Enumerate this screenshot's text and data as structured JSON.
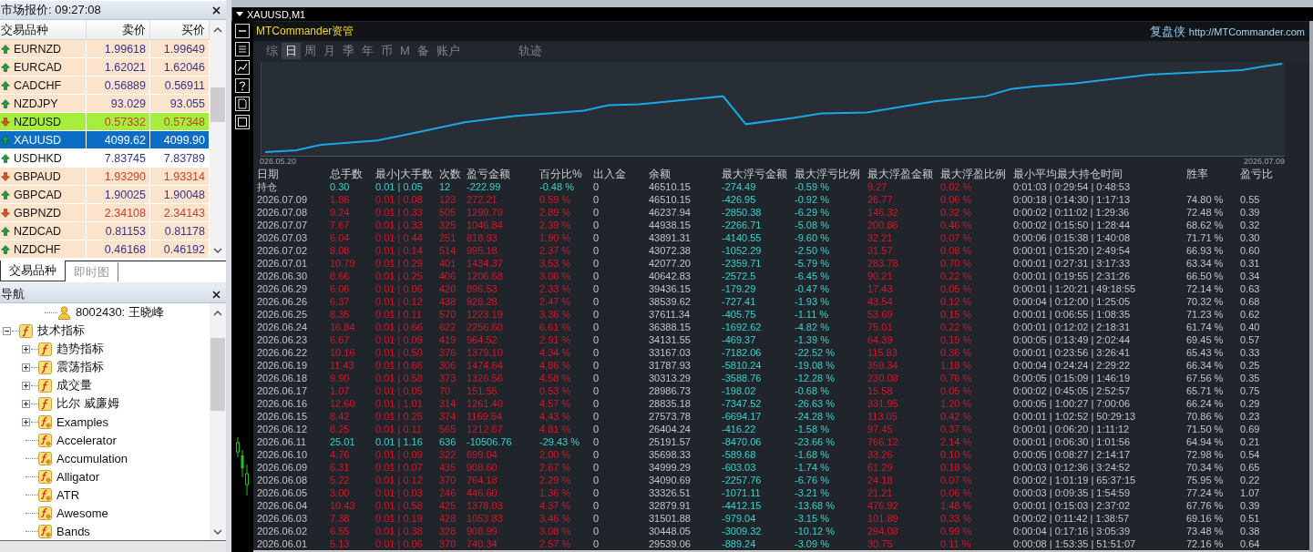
{
  "market_watch": {
    "title": "市场报价: 09:27:08",
    "columns": [
      "交易品种",
      "卖价",
      "买价"
    ],
    "rows": [
      {
        "symbol": "EURNZD",
        "bid": "1.99618",
        "ask": "1.99649",
        "rising": true,
        "selected": false,
        "color": "#fce3cc"
      },
      {
        "symbol": "EURCAD",
        "bid": "1.62021",
        "ask": "1.62046",
        "rising": true,
        "selected": false,
        "color": "#fce3cc"
      },
      {
        "symbol": "CADCHF",
        "bid": "0.56889",
        "ask": "0.56911",
        "rising": true,
        "selected": false,
        "color": "#fce3cc"
      },
      {
        "symbol": "NZDJPY",
        "bid": "93.029",
        "ask": "93.055",
        "rising": true,
        "selected": false,
        "color": "#fce3cc"
      },
      {
        "symbol": "NZDUSD",
        "bid": "0.57332",
        "ask": "0.57348",
        "rising": false,
        "selected": false,
        "color": "#a6ee3c"
      },
      {
        "symbol": "XAUUSD",
        "bid": "4099.62",
        "ask": "4099.90",
        "rising": true,
        "selected": true
      },
      {
        "symbol": "USDHKD",
        "bid": "7.83745",
        "ask": "7.83789",
        "rising": true,
        "selected": false,
        "color": "#ffffff"
      },
      {
        "symbol": "GBPAUD",
        "bid": "1.93290",
        "ask": "1.93314",
        "rising": false,
        "selected": false,
        "color": "#fce3cc"
      },
      {
        "symbol": "GBPCAD",
        "bid": "1.90025",
        "ask": "1.90048",
        "rising": true,
        "selected": false,
        "color": "#fce3cc"
      },
      {
        "symbol": "GBPNZD",
        "bid": "2.34108",
        "ask": "2.34143",
        "rising": false,
        "selected": false,
        "color": "#fce3cc"
      },
      {
        "symbol": "NZDCAD",
        "bid": "0.81153",
        "ask": "0.81178",
        "rising": true,
        "selected": false,
        "color": "#fce3cc"
      },
      {
        "symbol": "NZDCHF",
        "bid": "0.46168",
        "ask": "0.46192",
        "rising": true,
        "selected": false,
        "color": "#fce3cc"
      }
    ],
    "tabs": [
      {
        "label": "交易品种",
        "selected": true
      },
      {
        "label": "即时图",
        "selected": false
      }
    ]
  },
  "navigator": {
    "title": "导航",
    "account": {
      "label": "8002430: 王晓峰"
    },
    "tree": [
      {
        "label": "技术指标",
        "kind": "builtin",
        "expanded": true,
        "children": [
          {
            "label": "趋势指标",
            "kind": "builtin",
            "expanded": false
          },
          {
            "label": "震荡指标",
            "kind": "builtin",
            "expanded": false
          },
          {
            "label": "成交量",
            "kind": "builtin",
            "expanded": false
          },
          {
            "label": "比尔 威廉姆",
            "kind": "builtin",
            "expanded": false
          },
          {
            "label": "Examples",
            "kind": "custom",
            "expanded": false
          },
          {
            "label": "Accelerator",
            "kind": "custom"
          },
          {
            "label": "Accumulation",
            "kind": "custom"
          },
          {
            "label": "Alligator",
            "kind": "custom"
          },
          {
            "label": "ATR",
            "kind": "custom"
          },
          {
            "label": "Awesome",
            "kind": "custom"
          },
          {
            "label": "Bands",
            "kind": "custom"
          }
        ]
      }
    ]
  },
  "chart_window": {
    "title": "XAUUSD,M1",
    "panel": {
      "brand": "MTCommander资管",
      "site_name": "复盘侠",
      "site_url": "http://MTCommander.com",
      "tabs": [
        {
          "label": "综",
          "selected": false
        },
        {
          "label": "日",
          "selected": true
        },
        {
          "label": "周",
          "selected": false
        },
        {
          "label": "月",
          "selected": false
        },
        {
          "label": "季",
          "selected": false
        },
        {
          "label": "年",
          "selected": false
        },
        {
          "label": "币",
          "selected": false
        },
        {
          "label": "M",
          "selected": false
        },
        {
          "label": "备",
          "selected": false
        },
        {
          "label": "账户",
          "selected": false
        },
        {
          "label": "轨迹",
          "selected": false
        }
      ],
      "chart": {
        "start_label": "026.05.20",
        "end_label": "2026.07.09"
      },
      "table": {
        "columns": [
          "日期",
          "总手数",
          "最小|大手数",
          "次数",
          "盈亏金额",
          "百分比%",
          "出入金",
          "余额",
          "最大浮亏金额",
          "最大浮亏比例",
          "最大浮盈金额",
          "最大浮盈比例",
          "最小平均最大持仓时间",
          "胜率",
          "盈亏比"
        ],
        "rows": [
          {
            "cells": [
              "持仓",
              "0.30",
              "0.01 | 0.05",
              "12",
              "-222.99",
              "-0.48 %",
              "0",
              "46510.15",
              "-274.49",
              "-0.59 %",
              "9.27",
              "0.02 %",
              "0:01:03 | 0:29:54 | 0:48:53"
            ],
            "loss": true
          },
          {
            "cells": [
              "2026.07.09",
              "1.86",
              "0.01 | 0.08",
              "123",
              "272.21",
              "0.59 %",
              "0",
              "46510.15",
              "-426.95",
              "-0.92 %",
              "26.77",
              "0.06 %",
              "0:00:18 | 0:14:30 | 1:17:13",
              "74.80 %",
              "0.55"
            ],
            "loss": false
          },
          {
            "cells": [
              "2026.07.08",
              "9.24",
              "0.01 | 0.33",
              "505",
              "1299.79",
              "2.89 %",
              "0",
              "46237.94",
              "-2850.38",
              "-6.29 %",
              "146.32",
              "0.32 %",
              "0:00:02 | 0:11:02 | 1:29:36",
              "72.48 %",
              "0.39"
            ],
            "loss": false
          },
          {
            "cells": [
              "2026.07.07",
              "7.67",
              "0.01 | 0.33",
              "325",
              "1046.84",
              "2.39 %",
              "0",
              "44938.15",
              "-2266.71",
              "-5.08 %",
              "200.86",
              "0.46 %",
              "0:00:02 | 0:15:50 | 1:28:44",
              "68.62 %",
              "0.32"
            ],
            "loss": false
          },
          {
            "cells": [
              "2026.07.03",
              "6.04",
              "0.01 | 0.44",
              "251",
              "818.93",
              "1.90 %",
              "0",
              "43891.31",
              "-4140.55",
              "-9.60 %",
              "32.21",
              "0.07 %",
              "0:00:06 | 0:15:38 | 1:40:08",
              "71.71 %",
              "0.30"
            ],
            "loss": false
          },
          {
            "cells": [
              "2026.07.02",
              "8.08",
              "0.01 | 0.14",
              "514",
              "995.18",
              "2.37 %",
              "0",
              "43072.38",
              "-1052.29",
              "-2.50 %",
              "31.57",
              "0.08 %",
              "0:00:01 | 0:15:20 | 2:49:54",
              "66.93 %",
              "0.60"
            ],
            "loss": false
          },
          {
            "cells": [
              "2026.07.01",
              "10.79",
              "0.01 | 0.29",
              "401",
              "1434.37",
              "3.53 %",
              "0",
              "42077.20",
              "-2359.71",
              "-5.79 %",
              "283.78",
              "0.70 %",
              "0:00:01 | 0:27:31 | 3:17:33",
              "63.34 %",
              "0.31"
            ],
            "loss": false
          },
          {
            "cells": [
              "2026.06.30",
              "8.66",
              "0.01 | 0.25",
              "406",
              "1206.68",
              "3.06 %",
              "0",
              "40642.83",
              "-2572.5",
              "-6.45 %",
              "90.21",
              "0.22 %",
              "0:00:01 | 0:19:55 | 2:31:26",
              "66.50 %",
              "0.34"
            ],
            "loss": false
          },
          {
            "cells": [
              "2026.06.29",
              "6.06",
              "0.01 | 0.06",
              "420",
              "896.53",
              "2.33 %",
              "0",
              "39436.15",
              "-179.29",
              "-0.47 %",
              "17.43",
              "0.05 %",
              "0:00:01 | 1:20:21 | 49:18:55",
              "72.14 %",
              "0.63"
            ],
            "loss": false
          },
          {
            "cells": [
              "2026.06.26",
              "6.37",
              "0.01 | 0.12",
              "438",
              "928.28",
              "2.47 %",
              "0",
              "38539.62",
              "-727.41",
              "-1.93 %",
              "43.54",
              "0.12 %",
              "0:00:04 | 0:12:00 | 1:25:05",
              "70.32 %",
              "0.68"
            ],
            "loss": false
          },
          {
            "cells": [
              "2026.06.25",
              "8.35",
              "0.01 | 0.11",
              "570",
              "1223.19",
              "3.36 %",
              "0",
              "37611.34",
              "-405.75",
              "-1.11 %",
              "53.69",
              "0.15 %",
              "0:00:01 | 0:06:55 | 1:08:35",
              "71.23 %",
              "0.62"
            ],
            "loss": false
          },
          {
            "cells": [
              "2026.06.24",
              "16.84",
              "0.01 | 0.66",
              "622",
              "2256.60",
              "6.61 %",
              "0",
              "36388.15",
              "-1692.62",
              "-4.82 %",
              "75.01",
              "0.22 %",
              "0:00:01 | 0:12:02 | 2:18:31",
              "61.74 %",
              "0.40"
            ],
            "loss": false
          },
          {
            "cells": [
              "2026.06.23",
              "6.67",
              "0.01 | 0.09",
              "419",
              "964.52",
              "2.91 %",
              "0",
              "34131.55",
              "-469.37",
              "-1.39 %",
              "64.39",
              "0.19 %",
              "0:00:05 | 0:13:49 | 2:02:44",
              "69.45 %",
              "0.57"
            ],
            "loss": false
          },
          {
            "cells": [
              "2026.06.22",
              "10.16",
              "0.01 | 0.50",
              "376",
              "1379.10",
              "4.34 %",
              "0",
              "33167.03",
              "-7182.06",
              "-22.52 %",
              "115.83",
              "0.36 %",
              "0:00:01 | 0:23:56 | 3:26:41",
              "65.43 %",
              "0.33"
            ],
            "loss": false
          },
          {
            "cells": [
              "2026.06.19",
              "11.43",
              "0.01 | 0.66",
              "306",
              "1474.64",
              "4.86 %",
              "0",
              "31787.93",
              "-5810.24",
              "-19.08 %",
              "359.34",
              "1.18 %",
              "0:00:04 | 0:24:24 | 2:29:22",
              "66.34 %",
              "0.25"
            ],
            "loss": false
          },
          {
            "cells": [
              "2026.06.18",
              "9.90",
              "0.01 | 0.58",
              "373",
              "1326.56",
              "4.58 %",
              "0",
              "30313.29",
              "-3588.76",
              "-12.28 %",
              "230.08",
              "0.76 %",
              "0:00:05 | 0:15:09 | 1:46:19",
              "67.56 %",
              "0.35"
            ],
            "loss": false
          },
          {
            "cells": [
              "2026.06.17",
              "1.07",
              "0.01 | 0.05",
              "70",
              "151.55",
              "0.53 %",
              "0",
              "28986.73",
              "-198.02",
              "-0.68 %",
              "15.58",
              "0.05 %",
              "0:00:02 | 0:45:05 | 2:52:57",
              "65.71 %",
              "0.75"
            ],
            "loss": false
          },
          {
            "cells": [
              "2026.06.16",
              "12.60",
              "0.01 | 1.01",
              "314",
              "1261.40",
              "4.57 %",
              "0",
              "28835.18",
              "-7347.52",
              "-26.63 %",
              "331.95",
              "1.20 %",
              "0:00:05 | 1:00:27 | 7:00:06",
              "66.24 %",
              "0.29"
            ],
            "loss": false
          },
          {
            "cells": [
              "2026.06.15",
              "8.42",
              "0.01 | 0.25",
              "374",
              "1169.54",
              "4.43 %",
              "0",
              "27573.78",
              "-6694.17",
              "-24.28 %",
              "113.05",
              "0.42 %",
              "0:00:01 | 1:02:52 | 50:29:13",
              "70.86 %",
              "0.23"
            ],
            "loss": false
          },
          {
            "cells": [
              "2026.06.12",
              "8.25",
              "0.01 | 0.11",
              "565",
              "1212.67",
              "4.81 %",
              "0",
              "26404.24",
              "-416.22",
              "-1.58 %",
              "97.45",
              "0.37 %",
              "0:00:01 | 0:06:20 | 1:11:12",
              "71.50 %",
              "0.69"
            ],
            "loss": false
          },
          {
            "cells": [
              "2026.06.11",
              "25.01",
              "0.01 | 1.16",
              "636",
              "-10506.76",
              "-29.43 %",
              "0",
              "25191.57",
              "-8470.06",
              "-23.66 %",
              "766.12",
              "2.14 %",
              "0:00:01 | 0:06:30 | 1:01:56",
              "64.94 %",
              "0.21"
            ],
            "loss": true
          },
          {
            "cells": [
              "2026.06.10",
              "4.76",
              "0.01 | 0.09",
              "322",
              "699.04",
              "2.00 %",
              "0",
              "35698.33",
              "-589.68",
              "-1.68 %",
              "33.26",
              "0.10 %",
              "0:00:05 | 0:08:27 | 2:14:17",
              "72.98 %",
              "0.54"
            ],
            "loss": false
          },
          {
            "cells": [
              "2026.06.09",
              "6.31",
              "0.01 | 0.07",
              "435",
              "908.60",
              "2.67 %",
              "0",
              "34999.29",
              "-603.03",
              "-1.74 %",
              "61.29",
              "0.18 %",
              "0:00:03 | 0:12:36 | 3:24:52",
              "70.34 %",
              "0.65"
            ],
            "loss": false
          },
          {
            "cells": [
              "2026.06.08",
              "5.22",
              "0.01 | 0.12",
              "370",
              "764.18",
              "2.29 %",
              "0",
              "34090.69",
              "-2257.76",
              "-6.76 %",
              "24.18",
              "0.07 %",
              "0:00:02 | 1:01:19 | 65:37:15",
              "75.95 %",
              "0.22"
            ],
            "loss": false
          },
          {
            "cells": [
              "2026.06.05",
              "3.00",
              "0.01 | 0.03",
              "246",
              "446.60",
              "1.36 %",
              "0",
              "33326.51",
              "-1071.11",
              "-3.21 %",
              "21.21",
              "0.06 %",
              "0:00:03 | 0:09:35 | 1:54:59",
              "77.24 %",
              "1.07"
            ],
            "loss": false
          },
          {
            "cells": [
              "2026.06.04",
              "10.43",
              "0.01 | 0.58",
              "425",
              "1378.03",
              "4.37 %",
              "0",
              "32879.91",
              "-4412.15",
              "-13.68 %",
              "476.92",
              "1.48 %",
              "0:00:01 | 0:15:03 | 2:37:02",
              "67.76 %",
              "0.39"
            ],
            "loss": false
          },
          {
            "cells": [
              "2026.06.03",
              "7.38",
              "0.01 | 0.19",
              "428",
              "1053.83",
              "3.46 %",
              "0",
              "31501.88",
              "-979.04",
              "-3.15 %",
              "101.89",
              "0.33 %",
              "0:00:02 | 0:11:42 | 1:38:57",
              "69.16 %",
              "0.51"
            ],
            "loss": false
          },
          {
            "cells": [
              "2026.06.02",
              "6.55",
              "0.01 | 0.38",
              "328",
              "908.99",
              "3.08 %",
              "0",
              "30448.05",
              "-3009.32",
              "-10.12 %",
              "294.08",
              "0.99 %",
              "0:00:04 | 0:17:16 | 3:05:39",
              "73.48 %",
              "0.38"
            ],
            "loss": false
          },
          {
            "cells": [
              "2026.06.01",
              "5.13",
              "0.01 | 0.06",
              "370",
              "740.34",
              "2.57 %",
              "0",
              "29539.06",
              "-889.24",
              "-3.09 %",
              "30.75",
              "0.11 %",
              "0:00:08 | 1:53:35 | 51:51:07",
              "72.16 %",
              "0.64"
            ],
            "loss": false
          }
        ]
      }
    }
  }
}
